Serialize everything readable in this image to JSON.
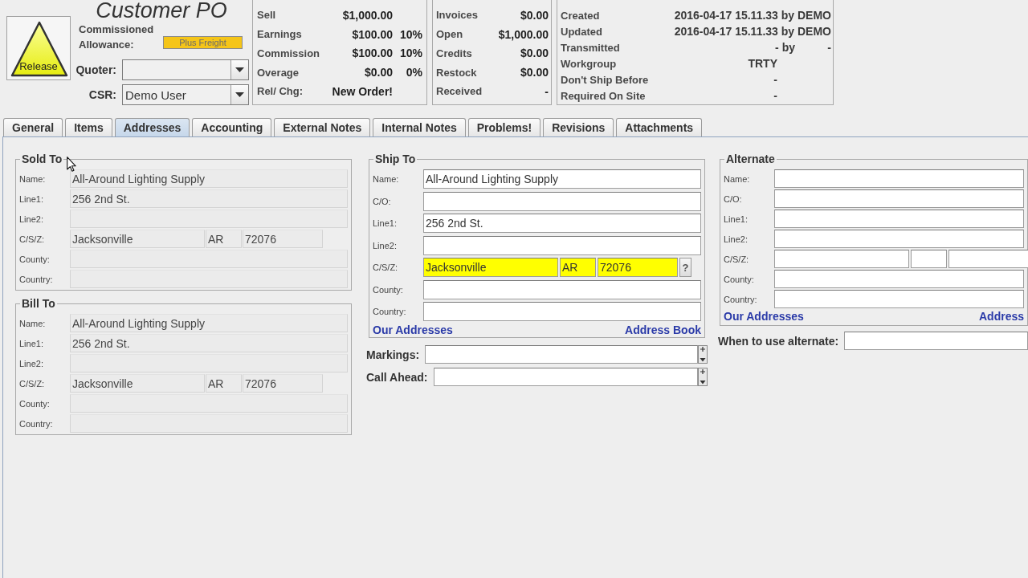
{
  "header": {
    "release_button": "Release",
    "title": "Customer PO",
    "allowance": {
      "label": "Commissioned Allowance:",
      "badge": "Plus Freight"
    },
    "selectors": [
      {
        "label": "Quoter:"
      },
      {
        "label": "CSR:",
        "value": "Demo User"
      }
    ]
  },
  "totals": [
    {
      "label": "Sell",
      "value": "$1,000.00"
    },
    {
      "label": "Earnings",
      "value": "$100.00",
      "percent": "10%"
    },
    {
      "label": "Commission",
      "value": "$100.00",
      "percent": "10%"
    },
    {
      "label": "Overage",
      "value": "$0.00",
      "percent": "0%"
    },
    {
      "label": "Rel/ Chg:",
      "value": "New Order!"
    }
  ],
  "invoices": [
    {
      "label": "Invoices",
      "value": "$0.00"
    },
    {
      "label": "Open",
      "value": "$1,000.00"
    },
    {
      "label": "Credits",
      "value": "$0.00"
    },
    {
      "label": "Restock",
      "value": "$0.00"
    },
    {
      "label": "Received",
      "value": "-"
    }
  ],
  "dates": [
    {
      "kind": "full",
      "label": "Created",
      "value": "2016-04-17 15.11.33 by DEMO"
    },
    {
      "kind": "full",
      "label": "Updated",
      "value": "2016-04-17 15.11.33 by DEMO"
    },
    {
      "kind": "split",
      "label": "Transmitted",
      "value": "- by",
      "value_2": "-"
    },
    {
      "kind": "short",
      "label": "Workgroup",
      "value": "TRTY"
    },
    {
      "kind": "short",
      "label": "Don't Ship Before",
      "value": "-"
    },
    {
      "kind": "short",
      "label": "Required On Site",
      "value": "-"
    }
  ],
  "tabs": [
    {
      "label": "General",
      "selected": false
    },
    {
      "label": "Items",
      "selected": false
    },
    {
      "label": "Addresses",
      "selected": true
    },
    {
      "label": "Accounting",
      "selected": false
    },
    {
      "label": "External Notes",
      "selected": false
    },
    {
      "label": "Internal Notes",
      "selected": false
    },
    {
      "label": "Problems!",
      "selected": false
    },
    {
      "label": "Revisions",
      "selected": false
    },
    {
      "label": "Attachments",
      "selected": false
    }
  ],
  "address_panel": {
    "sold_to": {
      "title": "Sold To",
      "disabled": true,
      "rows": [
        {
          "kind": "text",
          "label": "Name:",
          "value": "All-Around Lighting Supply",
          "highlighted": false
        },
        {
          "kind": "text",
          "label": "Line1:",
          "value": "256 2nd St.",
          "highlighted": false
        },
        {
          "kind": "text",
          "label": "Line2:",
          "highlighted": false
        },
        {
          "kind": "csz",
          "label": "C/S/Z:",
          "city": "Jacksonville",
          "state": "AR",
          "zip": "72076",
          "highlighted": false
        },
        {
          "kind": "text",
          "label": "County:",
          "highlighted": false
        },
        {
          "kind": "text",
          "label": "Country:",
          "highlighted": false
        }
      ]
    },
    "bill_to": {
      "title": "Bill To",
      "disabled": true,
      "rows": [
        {
          "kind": "text",
          "label": "Name:",
          "value": "All-Around Lighting Supply",
          "highlighted": false
        },
        {
          "kind": "text",
          "label": "Line1:",
          "value": "256 2nd St.",
          "highlighted": false
        },
        {
          "kind": "text",
          "label": "Line2:",
          "highlighted": false
        },
        {
          "kind": "csz",
          "label": "C/S/Z:",
          "city": "Jacksonville",
          "state": "AR",
          "zip": "72076",
          "highlighted": false
        },
        {
          "kind": "text",
          "label": "County:",
          "highlighted": false
        },
        {
          "kind": "text",
          "label": "Country:",
          "highlighted": false
        }
      ]
    },
    "ship_to": {
      "title": "Ship To",
      "disabled": false,
      "rows": [
        {
          "kind": "text",
          "label": "Name:",
          "value": "All-Around Lighting Supply",
          "highlighted": false
        },
        {
          "kind": "text",
          "label": "C/O:",
          "highlighted": false
        },
        {
          "kind": "text",
          "label": "Line1:",
          "value": "256 2nd St.",
          "highlighted": false
        },
        {
          "kind": "text",
          "label": "Line2:",
          "highlighted": false
        },
        {
          "kind": "csz",
          "label": "C/S/Z:",
          "city": "Jacksonville",
          "state": "AR",
          "zip": "72076",
          "lookup_button": "?",
          "highlighted": true
        },
        {
          "kind": "text",
          "label": "County:",
          "highlighted": false
        },
        {
          "kind": "text",
          "label": "Country:",
          "highlighted": false
        }
      ],
      "links": [
        "Our Addresses",
        "Address Book"
      ]
    },
    "ship_notes": [
      {
        "label": "Markings:"
      },
      {
        "label": "Call Ahead:"
      }
    ],
    "alternate": {
      "title": "Alternate",
      "disabled": false,
      "rows": [
        {
          "kind": "text",
          "label": "Name:",
          "highlighted": false
        },
        {
          "kind": "text",
          "label": "C/O:",
          "highlighted": false
        },
        {
          "kind": "text",
          "label": "Line1:",
          "highlighted": false
        },
        {
          "kind": "text",
          "label": "Line2:",
          "highlighted": false
        },
        {
          "kind": "csz",
          "label": "C/S/Z:",
          "highlighted": false
        },
        {
          "kind": "text",
          "label": "County:",
          "highlighted": false
        },
        {
          "kind": "text",
          "label": "Country:",
          "highlighted": false
        }
      ],
      "links": [
        "Our Addresses",
        "Address"
      ]
    },
    "alternate_note": {
      "label": "When to use alternate:"
    }
  }
}
